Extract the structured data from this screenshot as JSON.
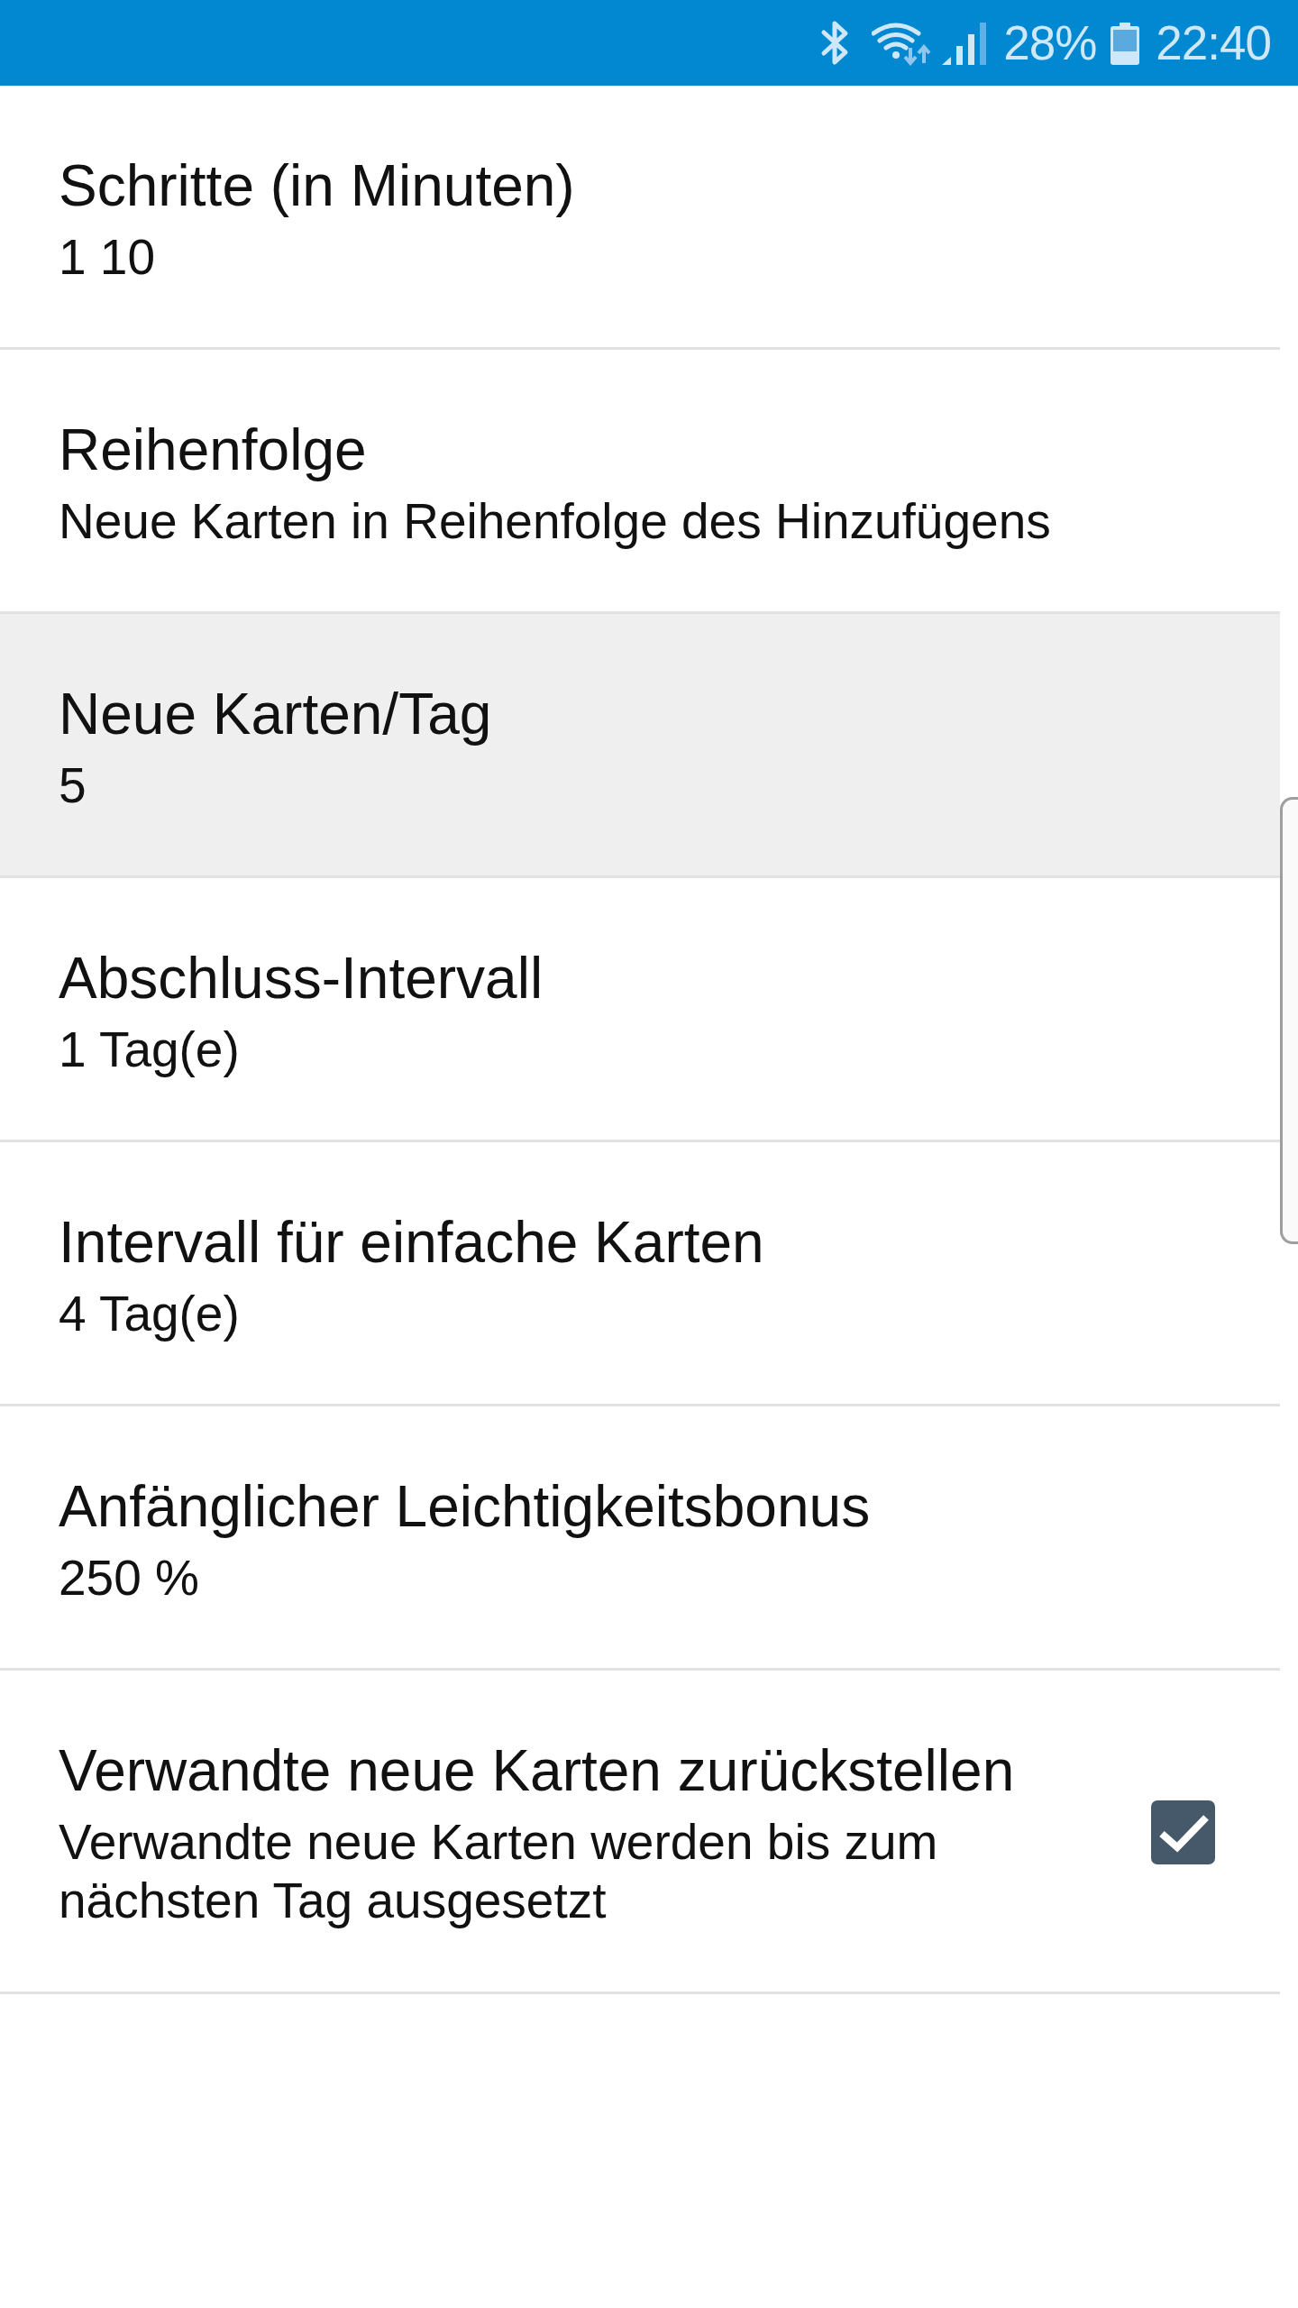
{
  "status_bar": {
    "battery": "28%",
    "time": "22:40"
  },
  "preferences": [
    {
      "kind": "text",
      "title": "Schritte (in Minuten)",
      "summary": "1 10",
      "selected": false
    },
    {
      "kind": "text",
      "title": "Reihenfolge",
      "summary": "Neue Karten in Reihenfolge des Hinzufügens",
      "selected": false
    },
    {
      "kind": "text",
      "title": "Neue Karten/Tag",
      "summary": "5",
      "selected": true
    },
    {
      "kind": "text",
      "title": "Abschluss-Intervall",
      "summary": "1 Tag(e)",
      "selected": false
    },
    {
      "kind": "text",
      "title": "Intervall für einfache Karten",
      "summary": "4 Tag(e)",
      "selected": false
    },
    {
      "kind": "text",
      "title": "Anfänglicher Leichtigkeitsbonus",
      "summary": "250 %",
      "selected": false
    },
    {
      "kind": "checkbox",
      "title": "Verwandte neue Karten zurückstellen",
      "summary": "Verwandte neue Karten werden bis zum nächsten Tag ausgesetzt",
      "selected": false,
      "checked": true
    }
  ]
}
